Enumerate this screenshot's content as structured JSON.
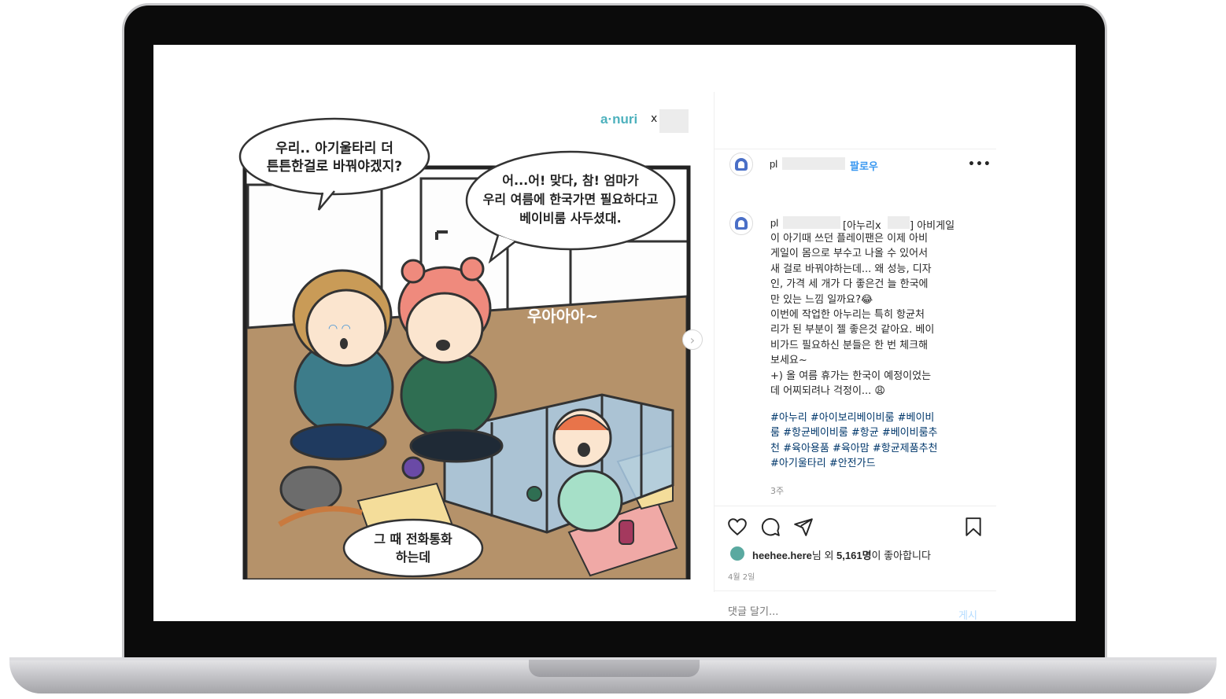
{
  "post": {
    "username_prefix": "pl",
    "follow_label": "팔로우",
    "more_label": "•••",
    "caption_username": "pl",
    "caption_tag_start": "[아누리x",
    "caption_tag_end": "] 아비게일",
    "caption_body": "이 아기때 쓰던 플레이팬은 이제 아비\n게일이 몸으로 부수고 나올 수 있어서\n새 걸로 바꿔야하는데... 왜 성능, 디자\n인, 가격 세 개가 다 좋은건 늘 한국에\n만 있는 느낌 일까요?😂\n이번에 작업한 아누리는 특히 항균처\n리가 된 부분이 젤 좋은것 같아요. 베이\n비가드 필요하신 분들은 한 번 체크해\n보세요~\n+) 올 여름 휴가는 한국이 예정이었는\n데 어찌되려나 걱정이... 😩",
    "hashtags": "#아누리 #아이보리베이비룸 #베이비\n룸 #항균베이비룸 #항균 #베이비룸추\n천 #육아용품 #육아맘 #항균제품추천\n#아기울타리 #안전가드",
    "time_ago": "3주",
    "likes_user": "heehee.here",
    "likes_text_mid": "님 외 ",
    "likes_count": "5,161명",
    "likes_text_end": "이 좋아합니다",
    "date": "4월 2일",
    "comment_placeholder": "댓글 달기...",
    "post_label": "게시"
  },
  "comic": {
    "brand": "a·nuri",
    "brand_x": "x",
    "bubble1_line1": "우리.. 아기울타리 더",
    "bubble1_line2": "튼튼한걸로 바꿔야겠지?",
    "bubble2_line1": "어...어! 맞다, 참! 엄마가",
    "bubble2_line2": "우리 여름에 한국가면 필요하다고",
    "bubble2_line3": "베이비룸 사두셨대.",
    "sound_effect": "우아아아~",
    "bubble3_line1": "그 때 전화통화",
    "bubble3_line2": "하는데"
  },
  "icons": {
    "heart": "heart-icon",
    "comment": "comment-icon",
    "share": "share-icon",
    "bookmark": "bookmark-icon",
    "next": "chevron-right-icon",
    "more": "more-icon"
  },
  "colors": {
    "link_blue": "#3897f0",
    "hashtag_blue": "#00376b",
    "muted_gray": "#8e8e8e",
    "floor_brown": "#b5926a",
    "fence_blue": "#a9cbe6"
  }
}
